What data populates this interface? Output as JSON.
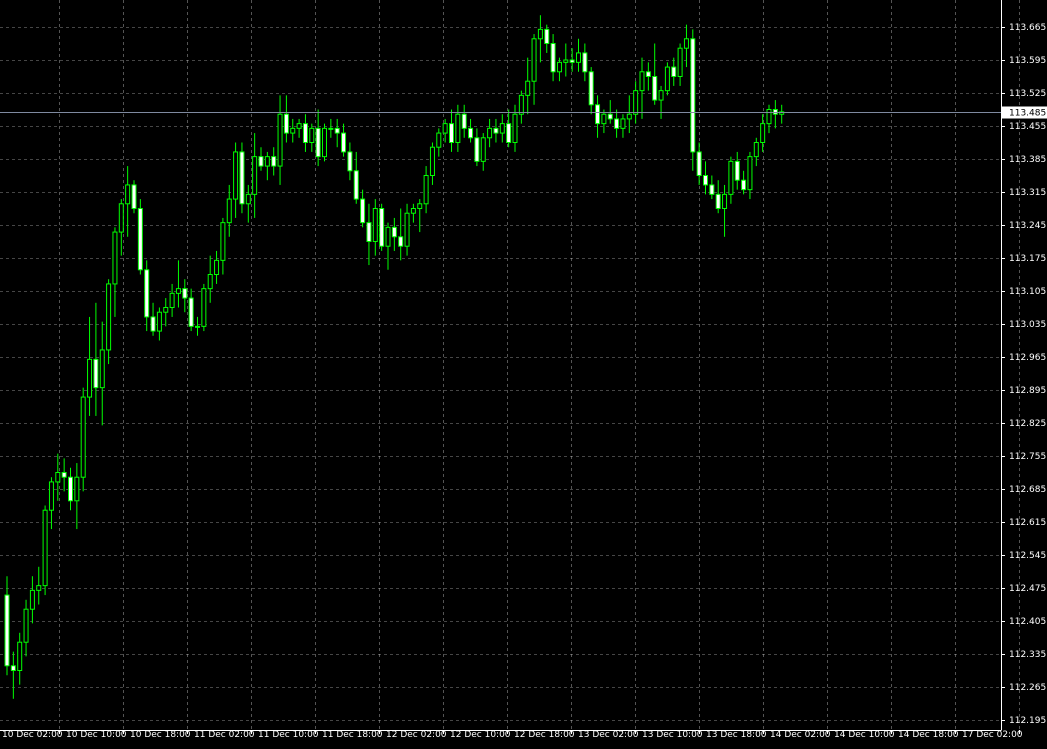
{
  "chart_data": {
    "type": "candlestick",
    "y_ticks": [
      "113.665",
      "113.595",
      "113.525",
      "113.455",
      "113.385",
      "113.315",
      "113.245",
      "113.175",
      "113.105",
      "113.035",
      "112.965",
      "112.895",
      "112.825",
      "112.755",
      "112.685",
      "112.615",
      "112.545",
      "112.475",
      "112.405",
      "112.335",
      "112.265",
      "112.195"
    ],
    "x_ticks": [
      "10 Dec 02:00",
      "10 Dec 10:00",
      "10 Dec 18:00",
      "11 Dec 02:00",
      "11 Dec 10:00",
      "11 Dec 18:00",
      "12 Dec 02:00",
      "12 Dec 10:00",
      "12 Dec 18:00",
      "13 Dec 02:00",
      "13 Dec 10:00",
      "13 Dec 18:00",
      "14 Dec 02:00",
      "14 Dec 10:00",
      "14 Dec 18:00",
      "17 Dec 02:00"
    ],
    "ylim": [
      112.18,
      113.695
    ],
    "current_price": "113.485",
    "grid": true,
    "colors": {
      "background": "#000000",
      "bull": "#00ff00",
      "bear": "#00ff00",
      "bull_body": "#000000",
      "bear_body": "#ffffff",
      "grid": "#ffffff",
      "price_line": "#7f8aa0",
      "axis_text": "#ffffff"
    },
    "candles": [
      {
        "o": 112.46,
        "h": 112.5,
        "l": 112.29,
        "c": 112.31
      },
      {
        "o": 112.31,
        "h": 112.34,
        "l": 112.24,
        "c": 112.3
      },
      {
        "o": 112.3,
        "h": 112.38,
        "l": 112.27,
        "c": 112.36
      },
      {
        "o": 112.36,
        "h": 112.45,
        "l": 112.33,
        "c": 112.43
      },
      {
        "o": 112.43,
        "h": 112.5,
        "l": 112.4,
        "c": 112.47
      },
      {
        "o": 112.47,
        "h": 112.52,
        "l": 112.44,
        "c": 112.48
      },
      {
        "o": 112.48,
        "h": 112.65,
        "l": 112.46,
        "c": 112.64
      },
      {
        "o": 112.64,
        "h": 112.71,
        "l": 112.6,
        "c": 112.7
      },
      {
        "o": 112.7,
        "h": 112.76,
        "l": 112.66,
        "c": 112.72
      },
      {
        "o": 112.72,
        "h": 112.75,
        "l": 112.68,
        "c": 112.71
      },
      {
        "o": 112.71,
        "h": 112.73,
        "l": 112.64,
        "c": 112.66
      },
      {
        "o": 112.66,
        "h": 112.74,
        "l": 112.6,
        "c": 112.71
      },
      {
        "o": 112.71,
        "h": 112.9,
        "l": 112.68,
        "c": 112.88
      },
      {
        "o": 112.88,
        "h": 113.05,
        "l": 112.84,
        "c": 112.96
      },
      {
        "o": 112.96,
        "h": 113.08,
        "l": 112.84,
        "c": 112.9
      },
      {
        "o": 112.9,
        "h": 113.04,
        "l": 112.82,
        "c": 112.98
      },
      {
        "o": 112.98,
        "h": 113.13,
        "l": 112.95,
        "c": 113.12
      },
      {
        "o": 113.12,
        "h": 113.24,
        "l": 113.05,
        "c": 113.23
      },
      {
        "o": 113.23,
        "h": 113.3,
        "l": 113.18,
        "c": 113.29
      },
      {
        "o": 113.29,
        "h": 113.37,
        "l": 113.22,
        "c": 113.33
      },
      {
        "o": 113.33,
        "h": 113.34,
        "l": 113.27,
        "c": 113.28
      },
      {
        "o": 113.28,
        "h": 113.3,
        "l": 113.14,
        "c": 113.15
      },
      {
        "o": 113.15,
        "h": 113.17,
        "l": 113.02,
        "c": 113.05
      },
      {
        "o": 113.05,
        "h": 113.08,
        "l": 113.01,
        "c": 113.02
      },
      {
        "o": 113.02,
        "h": 113.07,
        "l": 113.0,
        "c": 113.06
      },
      {
        "o": 113.06,
        "h": 113.09,
        "l": 113.03,
        "c": 113.07
      },
      {
        "o": 113.07,
        "h": 113.12,
        "l": 113.05,
        "c": 113.1
      },
      {
        "o": 113.1,
        "h": 113.17,
        "l": 113.07,
        "c": 113.11
      },
      {
        "o": 113.11,
        "h": 113.13,
        "l": 113.06,
        "c": 113.09
      },
      {
        "o": 113.09,
        "h": 113.11,
        "l": 113.02,
        "c": 113.03
      },
      {
        "o": 113.03,
        "h": 113.05,
        "l": 113.01,
        "c": 113.03
      },
      {
        "o": 113.03,
        "h": 113.12,
        "l": 113.02,
        "c": 113.11
      },
      {
        "o": 113.11,
        "h": 113.18,
        "l": 113.08,
        "c": 113.14
      },
      {
        "o": 113.14,
        "h": 113.19,
        "l": 113.12,
        "c": 113.17
      },
      {
        "o": 113.17,
        "h": 113.26,
        "l": 113.14,
        "c": 113.25
      },
      {
        "o": 113.25,
        "h": 113.33,
        "l": 113.22,
        "c": 113.3
      },
      {
        "o": 113.3,
        "h": 113.42,
        "l": 113.26,
        "c": 113.4
      },
      {
        "o": 113.4,
        "h": 113.42,
        "l": 113.27,
        "c": 113.29
      },
      {
        "o": 113.29,
        "h": 113.33,
        "l": 113.25,
        "c": 113.31
      },
      {
        "o": 113.31,
        "h": 113.44,
        "l": 113.26,
        "c": 113.39
      },
      {
        "o": 113.39,
        "h": 113.41,
        "l": 113.36,
        "c": 113.37
      },
      {
        "o": 113.37,
        "h": 113.4,
        "l": 113.34,
        "c": 113.39
      },
      {
        "o": 113.39,
        "h": 113.41,
        "l": 113.35,
        "c": 113.37
      },
      {
        "o": 113.37,
        "h": 113.52,
        "l": 113.33,
        "c": 113.48
      },
      {
        "o": 113.48,
        "h": 113.52,
        "l": 113.42,
        "c": 113.44
      },
      {
        "o": 113.44,
        "h": 113.47,
        "l": 113.42,
        "c": 113.45
      },
      {
        "o": 113.45,
        "h": 113.47,
        "l": 113.43,
        "c": 113.46
      },
      {
        "o": 113.46,
        "h": 113.48,
        "l": 113.4,
        "c": 113.42
      },
      {
        "o": 113.42,
        "h": 113.46,
        "l": 113.4,
        "c": 113.45
      },
      {
        "o": 113.45,
        "h": 113.49,
        "l": 113.37,
        "c": 113.39
      },
      {
        "o": 113.39,
        "h": 113.46,
        "l": 113.38,
        "c": 113.45
      },
      {
        "o": 113.45,
        "h": 113.47,
        "l": 113.43,
        "c": 113.45
      },
      {
        "o": 113.45,
        "h": 113.47,
        "l": 113.41,
        "c": 113.44
      },
      {
        "o": 113.44,
        "h": 113.46,
        "l": 113.39,
        "c": 113.4
      },
      {
        "o": 113.4,
        "h": 113.42,
        "l": 113.34,
        "c": 113.36
      },
      {
        "o": 113.36,
        "h": 113.4,
        "l": 113.29,
        "c": 113.3
      },
      {
        "o": 113.3,
        "h": 113.32,
        "l": 113.24,
        "c": 113.25
      },
      {
        "o": 113.25,
        "h": 113.29,
        "l": 113.16,
        "c": 113.21
      },
      {
        "o": 113.21,
        "h": 113.3,
        "l": 113.18,
        "c": 113.28
      },
      {
        "o": 113.28,
        "h": 113.29,
        "l": 113.19,
        "c": 113.2
      },
      {
        "o": 113.2,
        "h": 113.25,
        "l": 113.15,
        "c": 113.24
      },
      {
        "o": 113.24,
        "h": 113.26,
        "l": 113.19,
        "c": 113.22
      },
      {
        "o": 113.22,
        "h": 113.28,
        "l": 113.17,
        "c": 113.2
      },
      {
        "o": 113.2,
        "h": 113.29,
        "l": 113.18,
        "c": 113.27
      },
      {
        "o": 113.27,
        "h": 113.29,
        "l": 113.25,
        "c": 113.28
      },
      {
        "o": 113.28,
        "h": 113.3,
        "l": 113.23,
        "c": 113.29
      },
      {
        "o": 113.29,
        "h": 113.37,
        "l": 113.27,
        "c": 113.35
      },
      {
        "o": 113.35,
        "h": 113.42,
        "l": 113.33,
        "c": 113.41
      },
      {
        "o": 113.41,
        "h": 113.45,
        "l": 113.39,
        "c": 113.44
      },
      {
        "o": 113.44,
        "h": 113.47,
        "l": 113.42,
        "c": 113.46
      },
      {
        "o": 113.46,
        "h": 113.49,
        "l": 113.4,
        "c": 113.42
      },
      {
        "o": 113.42,
        "h": 113.5,
        "l": 113.4,
        "c": 113.48
      },
      {
        "o": 113.48,
        "h": 113.5,
        "l": 113.43,
        "c": 113.45
      },
      {
        "o": 113.45,
        "h": 113.47,
        "l": 113.42,
        "c": 113.43
      },
      {
        "o": 113.43,
        "h": 113.45,
        "l": 113.37,
        "c": 113.38
      },
      {
        "o": 113.38,
        "h": 113.44,
        "l": 113.36,
        "c": 113.43
      },
      {
        "o": 113.43,
        "h": 113.47,
        "l": 113.41,
        "c": 113.45
      },
      {
        "o": 113.45,
        "h": 113.47,
        "l": 113.42,
        "c": 113.44
      },
      {
        "o": 113.44,
        "h": 113.48,
        "l": 113.42,
        "c": 113.46
      },
      {
        "o": 113.46,
        "h": 113.49,
        "l": 113.41,
        "c": 113.42
      },
      {
        "o": 113.42,
        "h": 113.5,
        "l": 113.4,
        "c": 113.48
      },
      {
        "o": 113.48,
        "h": 113.53,
        "l": 113.46,
        "c": 113.52
      },
      {
        "o": 113.52,
        "h": 113.6,
        "l": 113.48,
        "c": 113.55
      },
      {
        "o": 113.55,
        "h": 113.65,
        "l": 113.5,
        "c": 113.64
      },
      {
        "o": 113.64,
        "h": 113.69,
        "l": 113.59,
        "c": 113.66
      },
      {
        "o": 113.66,
        "h": 113.67,
        "l": 113.61,
        "c": 113.63
      },
      {
        "o": 113.63,
        "h": 113.65,
        "l": 113.55,
        "c": 113.57
      },
      {
        "o": 113.57,
        "h": 113.6,
        "l": 113.55,
        "c": 113.59
      },
      {
        "o": 113.59,
        "h": 113.63,
        "l": 113.56,
        "c": 113.595
      },
      {
        "o": 113.595,
        "h": 113.62,
        "l": 113.57,
        "c": 113.59
      },
      {
        "o": 113.59,
        "h": 113.64,
        "l": 113.57,
        "c": 113.61
      },
      {
        "o": 113.61,
        "h": 113.63,
        "l": 113.55,
        "c": 113.57
      },
      {
        "o": 113.57,
        "h": 113.58,
        "l": 113.48,
        "c": 113.5
      },
      {
        "o": 113.5,
        "h": 113.52,
        "l": 113.43,
        "c": 113.46
      },
      {
        "o": 113.46,
        "h": 113.49,
        "l": 113.44,
        "c": 113.48
      },
      {
        "o": 113.48,
        "h": 113.51,
        "l": 113.46,
        "c": 113.47
      },
      {
        "o": 113.47,
        "h": 113.49,
        "l": 113.43,
        "c": 113.45
      },
      {
        "o": 113.45,
        "h": 113.48,
        "l": 113.43,
        "c": 113.47
      },
      {
        "o": 113.47,
        "h": 113.52,
        "l": 113.44,
        "c": 113.48
      },
      {
        "o": 113.48,
        "h": 113.55,
        "l": 113.46,
        "c": 113.53
      },
      {
        "o": 113.53,
        "h": 113.6,
        "l": 113.47,
        "c": 113.57
      },
      {
        "o": 113.57,
        "h": 113.59,
        "l": 113.53,
        "c": 113.56
      },
      {
        "o": 113.56,
        "h": 113.63,
        "l": 113.5,
        "c": 113.51
      },
      {
        "o": 113.51,
        "h": 113.54,
        "l": 113.47,
        "c": 113.53
      },
      {
        "o": 113.53,
        "h": 113.59,
        "l": 113.52,
        "c": 113.58
      },
      {
        "o": 113.58,
        "h": 113.6,
        "l": 113.54,
        "c": 113.56
      },
      {
        "o": 113.56,
        "h": 113.63,
        "l": 113.54,
        "c": 113.62
      },
      {
        "o": 113.62,
        "h": 113.67,
        "l": 113.58,
        "c": 113.64
      },
      {
        "o": 113.64,
        "h": 113.66,
        "l": 113.36,
        "c": 113.4
      },
      {
        "o": 113.4,
        "h": 113.42,
        "l": 113.33,
        "c": 113.35
      },
      {
        "o": 113.35,
        "h": 113.38,
        "l": 113.31,
        "c": 113.33
      },
      {
        "o": 113.33,
        "h": 113.35,
        "l": 113.3,
        "c": 113.31
      },
      {
        "o": 113.31,
        "h": 113.34,
        "l": 113.27,
        "c": 113.28
      },
      {
        "o": 113.28,
        "h": 113.33,
        "l": 113.22,
        "c": 113.31
      },
      {
        "o": 113.31,
        "h": 113.39,
        "l": 113.29,
        "c": 113.38
      },
      {
        "o": 113.38,
        "h": 113.4,
        "l": 113.32,
        "c": 113.34
      },
      {
        "o": 113.34,
        "h": 113.36,
        "l": 113.31,
        "c": 113.32
      },
      {
        "o": 113.32,
        "h": 113.4,
        "l": 113.3,
        "c": 113.39
      },
      {
        "o": 113.39,
        "h": 113.43,
        "l": 113.37,
        "c": 113.42
      },
      {
        "o": 113.42,
        "h": 113.48,
        "l": 113.4,
        "c": 113.46
      },
      {
        "o": 113.46,
        "h": 113.5,
        "l": 113.44,
        "c": 113.49
      },
      {
        "o": 113.49,
        "h": 113.51,
        "l": 113.45,
        "c": 113.48
      },
      {
        "o": 113.48,
        "h": 113.5,
        "l": 113.46,
        "c": 113.485
      }
    ]
  }
}
